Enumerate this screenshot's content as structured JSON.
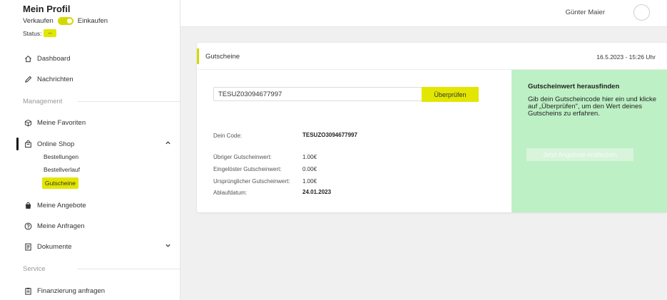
{
  "sidebar": {
    "profile_title": "Mein Profil",
    "mode_sell": "Verkaufen",
    "mode_buy": "Einkaufen",
    "status_label": "Status:",
    "status_value": "--",
    "items": {
      "dashboard": "Dashboard",
      "messages": "Nachrichten",
      "favorites": "Meine Favoriten",
      "online_shop": "Online Shop",
      "offers": "Meine Angebote",
      "requests": "Meine Anfragen",
      "documents": "Dokumente",
      "financing": "Finanzierung anfragen"
    },
    "sections": {
      "management": "Management",
      "service": "Service"
    },
    "sub_items": {
      "orders": "Bestellungen",
      "order_history": "Bestellverlauf",
      "vouchers": "Gutscheine"
    },
    "colors": {
      "accent": "#e2e600"
    }
  },
  "topbar": {
    "user_name": "Günter Maier"
  },
  "card": {
    "title": "Gutscheine",
    "date": "16.5.2023 - 15:26 Uhr",
    "code_input_value": "TESUZ03094677997",
    "check_button": "Überprüfen",
    "details": {
      "your_code_label": "Dein Code:",
      "your_code_value": "TESUZO3094677997",
      "remaining_label": "Übriger Gutscheinwert:",
      "remaining_value": "1.00€",
      "redeemed_label": "Eingelöster Gutscheinwert:",
      "redeemed_value": "0.00€",
      "original_label": "Ursprünglicher Gutscheinwert:",
      "original_value": "1.00€",
      "expiry_label": "Ablaufdatum:",
      "expiry_value": "24.01.2023"
    },
    "info_panel": {
      "title": "Gutscheinwert herausfinden",
      "text": "Gib dein Gutscheincode hier ein und klicke auf „Überprüfen\", um den Wert deines Gutscheins zu erfahren.",
      "button": "Jetzt Angebote entdecken",
      "color": "#bdf0c4"
    }
  }
}
